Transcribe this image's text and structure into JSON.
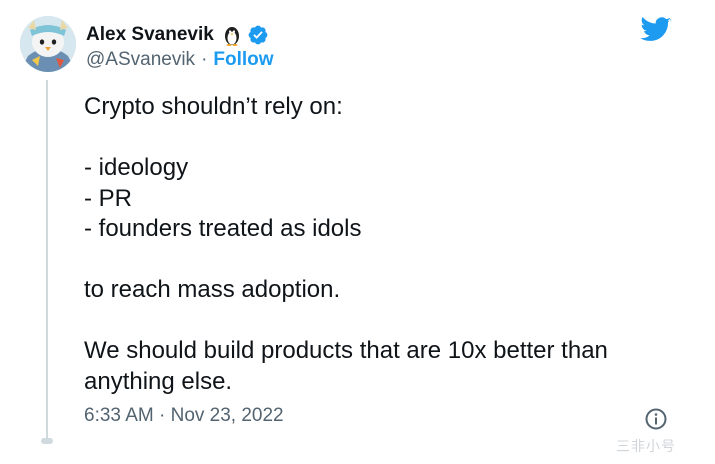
{
  "author": {
    "display_name": "Alex Svanevik",
    "handle": "@ASvanevik",
    "follow_label": "Follow",
    "separator": "·"
  },
  "icons": {
    "avatar": "penguin-avatar",
    "name_emoji": "penguin-icon",
    "verified": "verified-badge-icon",
    "brand": "twitter-bird-icon",
    "info": "info-icon"
  },
  "tweet": {
    "lines": [
      "Crypto shouldn’t rely on:",
      "",
      "- ideology",
      "- PR",
      "- founders treated as idols",
      "",
      "to reach mass adoption.",
      "",
      "We should build products that are 10x better than",
      "anything else."
    ],
    "timestamp": "6:33 AM · Nov 23, 2022"
  },
  "colors": {
    "link": "#1d9bf0",
    "text": "#0f1419",
    "secondary": "#536471",
    "thread_line": "#cfd9de"
  },
  "watermark": {
    "text": "三非小号"
  }
}
